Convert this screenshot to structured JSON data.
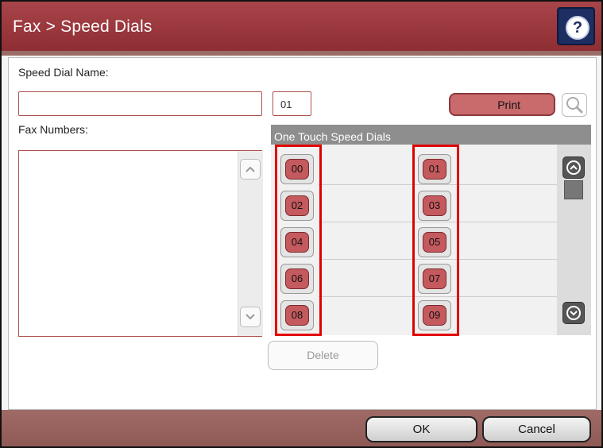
{
  "header": {
    "title": "Fax > Speed Dials",
    "help_icon": "help-icon",
    "help_glyph": "?"
  },
  "form": {
    "speed_dial_name_label": "Speed Dial Name:",
    "speed_dial_name_value": "",
    "speed_dial_number_value": "01",
    "fax_numbers_label": "Fax Numbers:",
    "print_label": "Print",
    "search_icon": "magnifier-icon"
  },
  "one_touch": {
    "header": "One Touch Speed Dials",
    "left_column": [
      "00",
      "02",
      "04",
      "06",
      "08"
    ],
    "right_column": [
      "01",
      "03",
      "05",
      "07",
      "09"
    ]
  },
  "actions": {
    "delete_label": "Delete",
    "ok_label": "OK",
    "cancel_label": "Cancel"
  },
  "colors": {
    "title_bar": "#9b3a40",
    "speed_dial_button": "#c55a5e",
    "highlight": "#e10000",
    "help_button": "#1d2e63"
  }
}
